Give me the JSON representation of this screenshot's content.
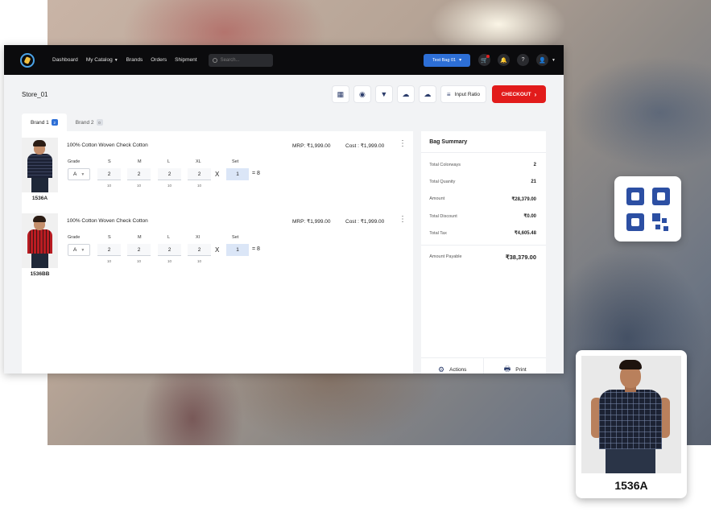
{
  "nav": {
    "items": [
      "Dashboard",
      "My Catalog",
      "Brands",
      "Orders",
      "Shipment"
    ],
    "search_placeholder": "Search...",
    "bag_select": "Test Bag 01"
  },
  "store": {
    "name": "Store_01"
  },
  "toolbar": {
    "input_ratio_label": "Input Ratio",
    "checkout_label": "CHECKOUT"
  },
  "tabs": [
    {
      "label": "Brand 1",
      "badge": "2"
    },
    {
      "label": "Brand 2",
      "badge": "0"
    }
  ],
  "grid_headers": {
    "grade": "Grade",
    "sizes": [
      "S",
      "M",
      "L",
      "XL"
    ],
    "set": "Set"
  },
  "products": [
    {
      "sku": "1536A",
      "title": "100% Cotton Woven Check Cotton",
      "mrp": "MRP: ₹1,999.00",
      "cost": "Cost : ₹1,999.00",
      "grade": "A",
      "size_headers": [
        "S",
        "M",
        "L",
        "XL"
      ],
      "qty": [
        "2",
        "2",
        "2",
        "2"
      ],
      "stock": [
        "10",
        "10",
        "10",
        "10"
      ],
      "set": "1",
      "x_label": "X",
      "eq_label": "= 8"
    },
    {
      "sku": "1536BB",
      "title": "100% Cotton Woven Check Cotton",
      "mrp": "MRP: ₹1,999.00",
      "cost": "Cost : ₹1,999.00",
      "grade": "A",
      "size_headers": [
        "S",
        "M",
        "L",
        "Xl"
      ],
      "qty": [
        "2",
        "2",
        "2",
        "2"
      ],
      "stock": [
        "10",
        "10",
        "10",
        "10"
      ],
      "set": "1",
      "x_label": "X",
      "eq_label": "= 8"
    }
  ],
  "summary": {
    "title": "Bag Summary",
    "rows": [
      {
        "label": "Total Colorways",
        "value": "2"
      },
      {
        "label": "Total Quanity",
        "value": "21"
      },
      {
        "label": "Amount",
        "value": "₹28,379.00"
      },
      {
        "label": "Total Discount",
        "value": "₹0.00"
      },
      {
        "label": "Total Tax",
        "value": "₹4,605.48"
      }
    ],
    "payable_label": "Amount Payable",
    "payable_value": "₹38,379.00",
    "actions_label": "Actions",
    "print_label": "Print"
  },
  "sku_card": {
    "label": "1536A"
  },
  "icons": {
    "qr": "qr-code-icon",
    "eye": "eye-icon",
    "filter": "filter-icon",
    "upload": "cloud-upload-icon",
    "download": "cloud-download-icon",
    "cart": "cart-icon",
    "bell": "bell-icon",
    "help": "help-icon",
    "user": "user-icon",
    "gear": "gear-icon",
    "printer": "printer-icon"
  },
  "colors": {
    "accent": "#2d6fd6",
    "checkout": "#e21b1b",
    "topbar": "#0b0b0d",
    "qr": "#2c4fa3"
  }
}
